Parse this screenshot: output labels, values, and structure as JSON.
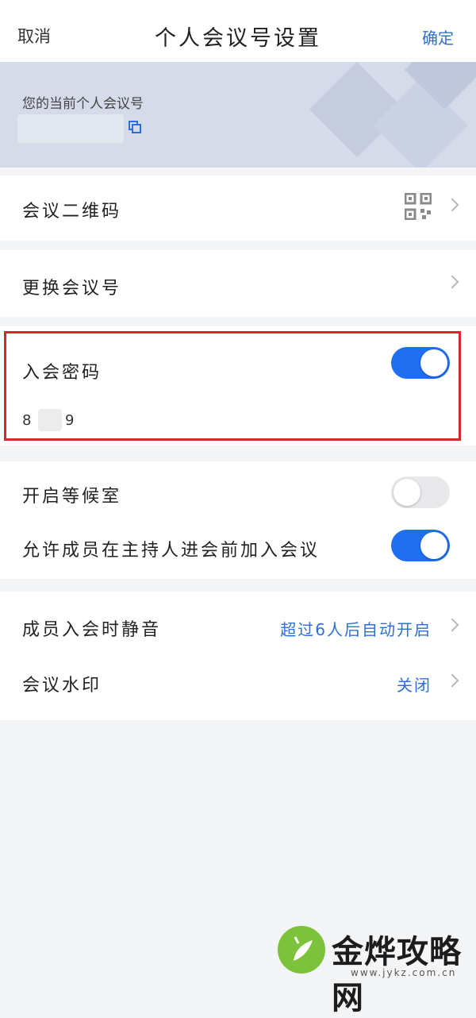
{
  "header": {
    "cancel_label": "取消",
    "title": "个人会议号设置",
    "confirm_label": "确定"
  },
  "banner": {
    "label": "您的当前个人会议号"
  },
  "rows": {
    "qr_label": "会议二维码",
    "change_label": "更换会议号"
  },
  "password": {
    "label": "入会密码",
    "enabled": true,
    "value_start": "8",
    "value_end": "9"
  },
  "waiting": {
    "waiting_room_label": "开启等候室",
    "waiting_room_enabled": false,
    "allow_before_host_label": "允许成员在主持人进会前加入会议",
    "allow_before_host_enabled": true
  },
  "audio": {
    "mute_label": "成员入会时静音",
    "mute_value": "超过6人后自动开启",
    "watermark_label": "会议水印",
    "watermark_value": "关闭"
  },
  "watermark_brand": {
    "name": "金烨攻略网",
    "url": "www.jykz.com.cn"
  },
  "colors": {
    "accent": "#1f6ff0",
    "highlight_box": "#d42a2a"
  }
}
